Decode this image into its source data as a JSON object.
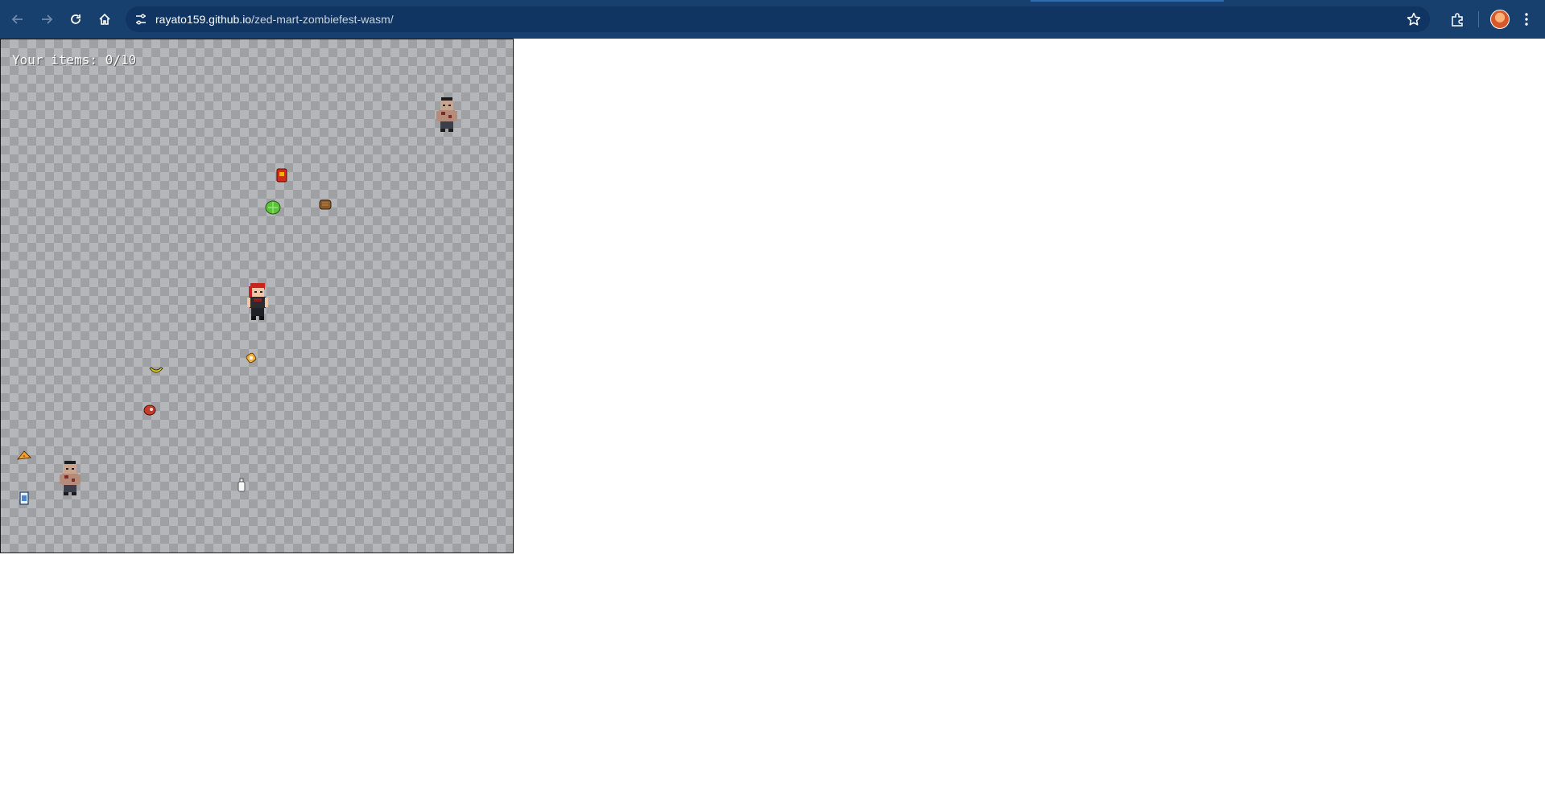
{
  "browser": {
    "url_host": "rayato159.github.io",
    "url_path": "/zed-mart-zombiefest-wasm/",
    "icons": [
      "back-arrow-icon",
      "forward-arrow-icon",
      "reload-icon",
      "home-icon",
      "site-info-icon",
      "bookmark-star-icon",
      "extensions-icon",
      "profile-avatar-icon",
      "menu-kebab-icon"
    ]
  },
  "game": {
    "hud_text": "Your items: 0/10",
    "items_collected": 0,
    "items_total": 10,
    "entities": [
      "player",
      "zombie",
      "zombie",
      "red-can",
      "green-cabbage",
      "brown-bread",
      "bandage",
      "banana",
      "meat",
      "cheese",
      "milk-bottle",
      "juice-carton"
    ]
  },
  "colors": {
    "toolbar": "#18406e",
    "omnibox": "#103562",
    "checker_light": "#b4b6ba",
    "checker_dark": "#9ea0a4"
  }
}
